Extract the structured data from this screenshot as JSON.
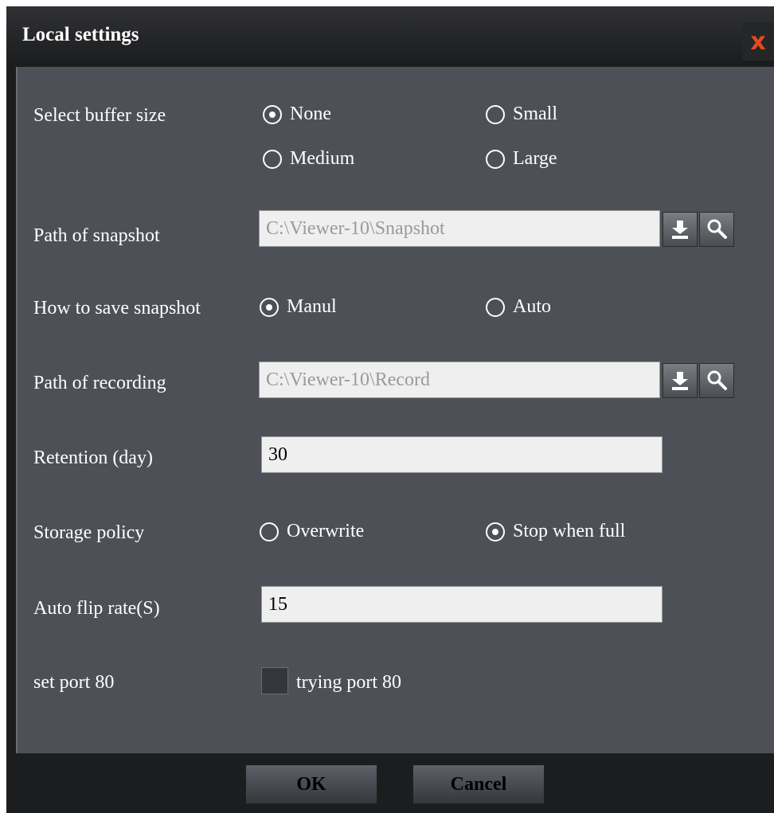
{
  "dialog": {
    "title": "Local settings",
    "close_label": "x"
  },
  "buffer": {
    "label": "Select buffer size",
    "options": [
      {
        "label": "None",
        "selected": true
      },
      {
        "label": "Small",
        "selected": false
      },
      {
        "label": "Medium",
        "selected": false
      },
      {
        "label": "Large",
        "selected": false
      }
    ]
  },
  "snapshot_path": {
    "label": "Path of snapshot",
    "value": "C:\\Viewer-10\\Snapshot"
  },
  "snapshot_save": {
    "label": "How to save snapshot",
    "options": [
      {
        "label": "Manul",
        "selected": true
      },
      {
        "label": "Auto",
        "selected": false
      }
    ]
  },
  "recording_path": {
    "label": "Path of recording",
    "value": "C:\\Viewer-10\\Record"
  },
  "retention": {
    "label": "Retention (day)",
    "value": "30"
  },
  "storage_policy": {
    "label": "Storage policy",
    "options": [
      {
        "label": "Overwrite",
        "selected": false
      },
      {
        "label": "Stop when full",
        "selected": true
      }
    ]
  },
  "auto_flip": {
    "label": "Auto flip rate(S)",
    "value": "15"
  },
  "port": {
    "label": "set port 80",
    "checkbox_label": "trying port 80",
    "checked": false
  },
  "footer": {
    "ok_label": "OK",
    "cancel_label": "Cancel"
  },
  "icons": {
    "download": "download-icon",
    "search": "search-icon",
    "close": "close-icon"
  },
  "colors": {
    "accent_close": "#e44b1c",
    "panel_bg": "#4d5157",
    "frame_bg": "#1c1d1f"
  }
}
